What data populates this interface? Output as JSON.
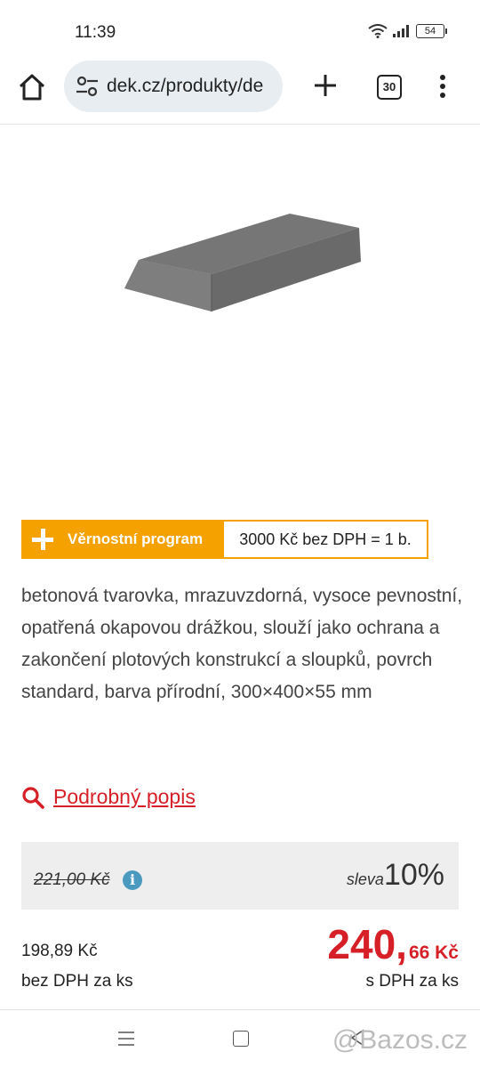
{
  "status_bar": {
    "time": "11:39",
    "battery": "54"
  },
  "browser": {
    "url": "dek.cz/produkty/de",
    "tab_count": "30"
  },
  "loyalty": {
    "label": "Věrnostní program",
    "rate": "3000 Kč bez DPH = 1 b."
  },
  "product": {
    "description": "betonová tvarovka, mrazuvzdorná, vysoce pevnostní, opatřená okapovou drážkou, slouží jako ochrana a zakončení plotových konstrukcí a sloupků, povrch standard, barva přírodní, 300×400×55 mm",
    "detail_link": "Podrobný popis"
  },
  "pricing": {
    "old_price": "221,00 Kč",
    "discount_label": "sleva",
    "discount_value": "10%",
    "net_price": "198,89 Kč",
    "net_label": "bez DPH za ks",
    "gross_main": "240,",
    "gross_fraction": "66 Kč",
    "gross_label": "s DPH za ks"
  },
  "watermark": "@Bazos.cz",
  "colors": {
    "accent_red": "#d61f26",
    "loyalty_orange": "#f5a200",
    "info_blue": "#4a9ac0"
  }
}
